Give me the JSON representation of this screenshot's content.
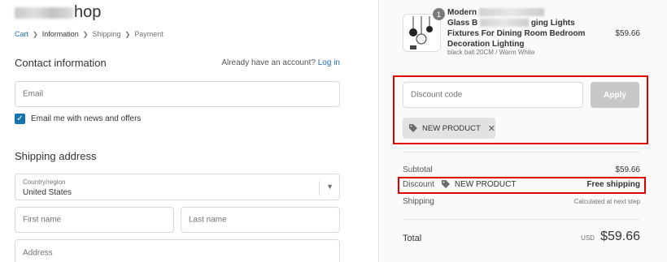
{
  "shop": {
    "logo_visible_text": "hop"
  },
  "breadcrumb": {
    "items": [
      {
        "label": "Cart",
        "state": "link"
      },
      {
        "label": "Information",
        "state": "current"
      },
      {
        "label": "Shipping",
        "state": "upcoming"
      },
      {
        "label": "Payment",
        "state": "upcoming"
      }
    ]
  },
  "contact": {
    "title": "Contact information",
    "account_prompt": "Already have an account?",
    "login_label": "Log in",
    "email_placeholder": "Email",
    "newsletter_label": "Email me with news and offers",
    "newsletter_checked": true
  },
  "shipping": {
    "title": "Shipping address",
    "country_label": "Country/region",
    "country_value": "United States",
    "first_name_placeholder": "First name",
    "last_name_placeholder": "Last name",
    "address_placeholder": "Address"
  },
  "order": {
    "product": {
      "quantity": "1",
      "name_visible_start": "Modern",
      "name_visible_mid": "ging Lights",
      "name_line2": "Glass B",
      "name_line3": "Fixtures For Dining Room Bedroom",
      "name_line4": "Decoration Lighting",
      "variant": "black ball 20CM / Warm White",
      "price": "$59.66"
    },
    "discount": {
      "placeholder": "Discount code",
      "apply_label": "Apply",
      "applied_code": "NEW PRODUCT"
    },
    "summary": {
      "subtotal_label": "Subtotal",
      "subtotal_value": "$59.66",
      "discount_label": "Discount",
      "discount_code": "NEW PRODUCT",
      "discount_value": "Free shipping",
      "shipping_label": "Shipping",
      "shipping_value": "Calculated at next step",
      "total_label": "Total",
      "total_currency": "USD",
      "total_value": "$59.66"
    }
  },
  "colors": {
    "link": "#1e6eb4",
    "checkbox": "#1773b0",
    "highlight": "#e00000",
    "apply_disabled": "#c8c8c8"
  }
}
